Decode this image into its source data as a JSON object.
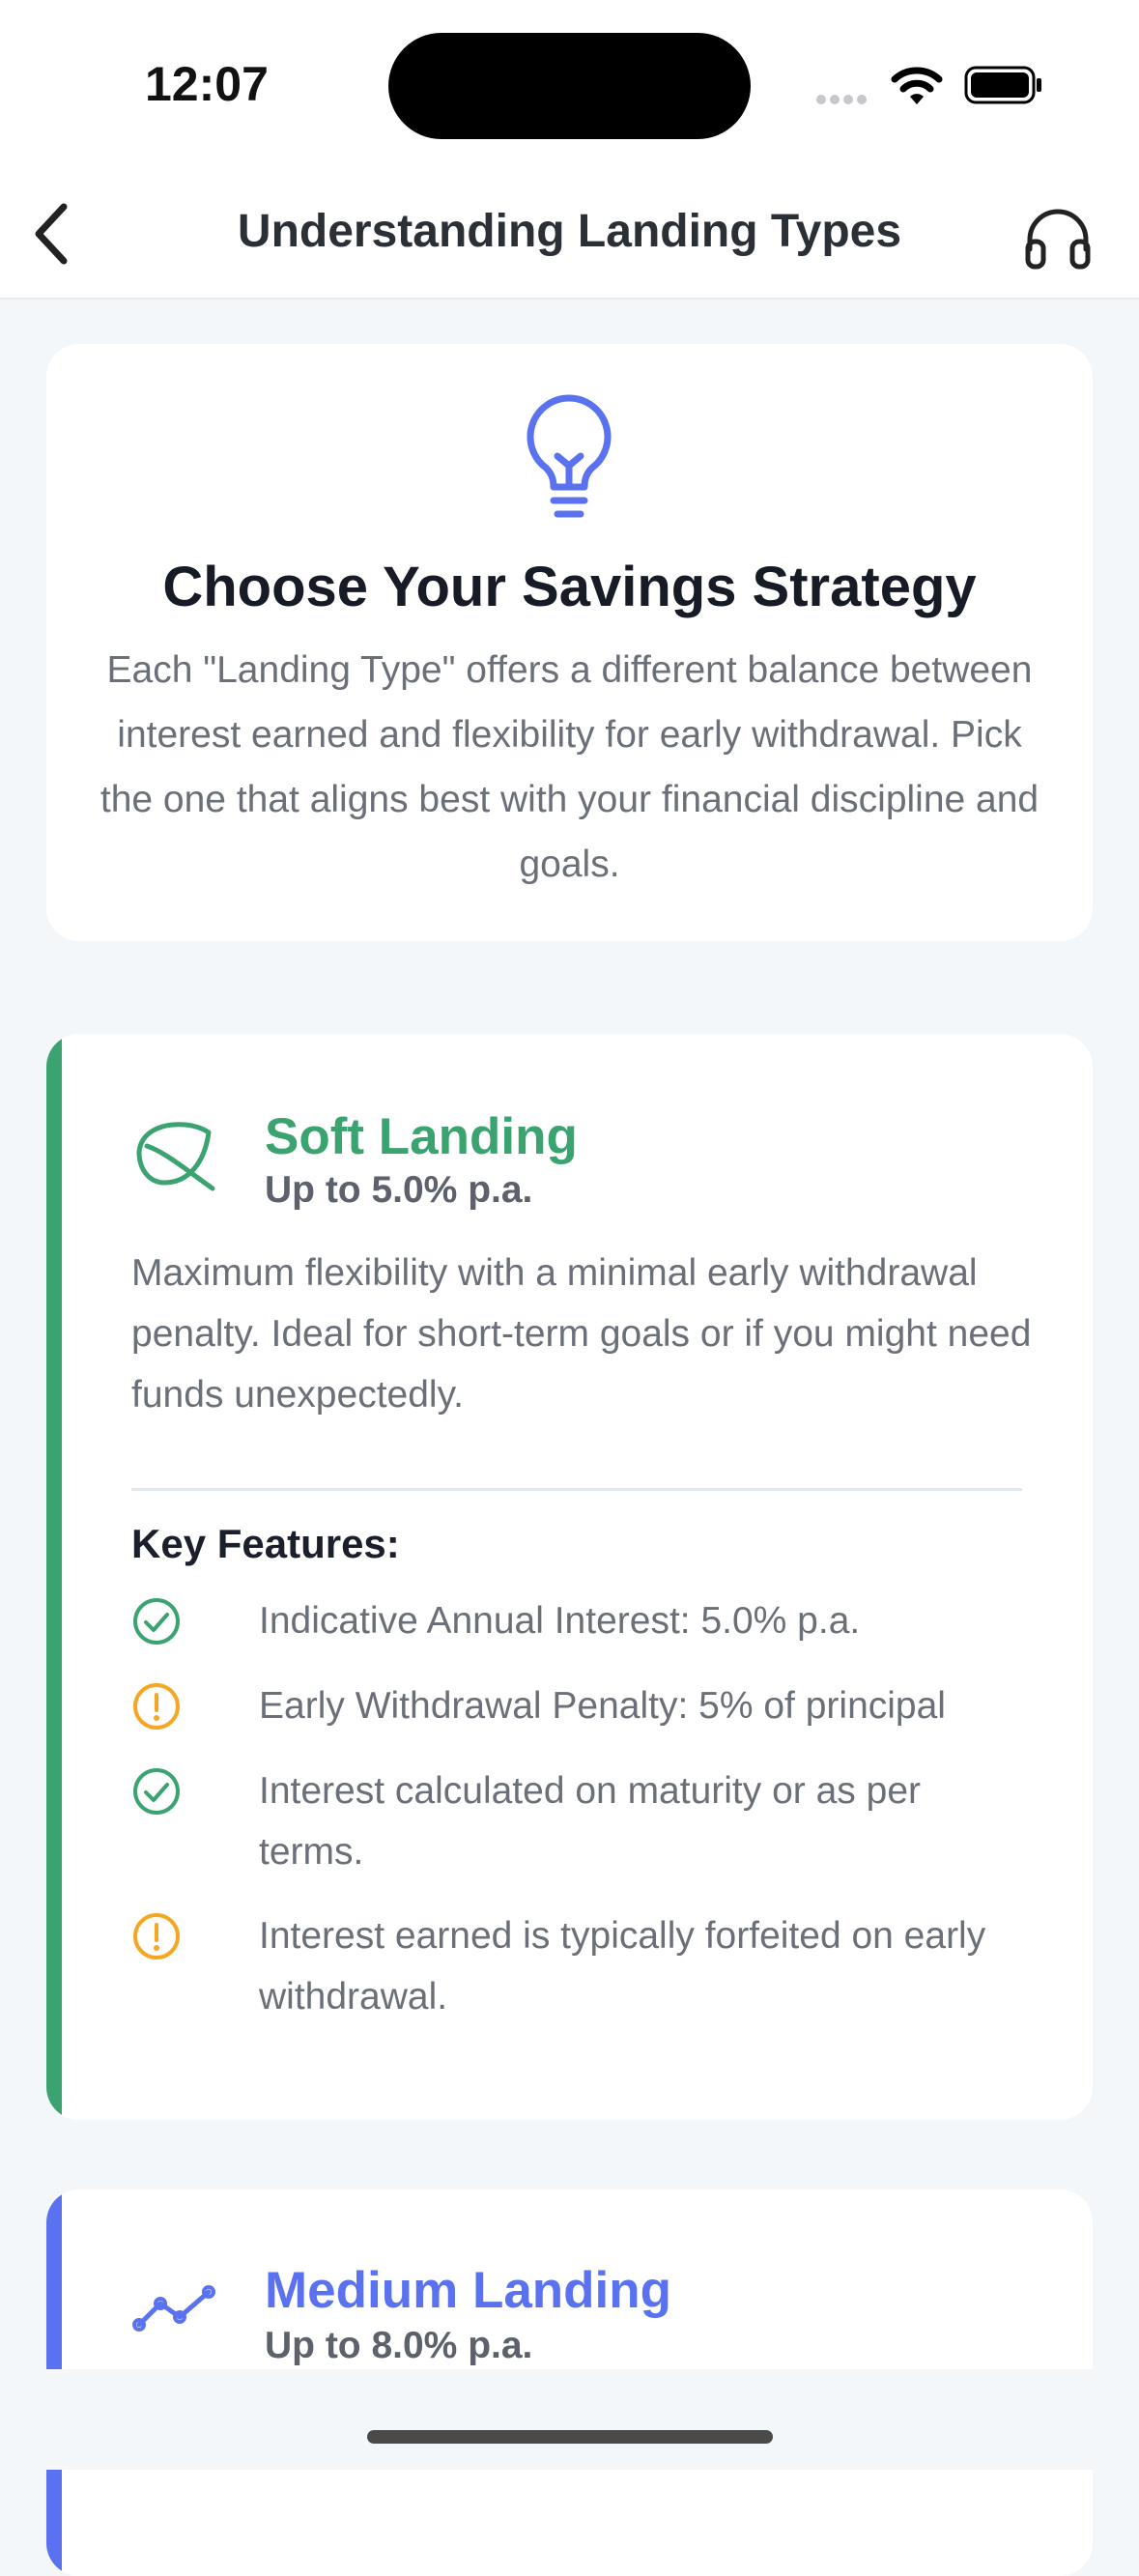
{
  "status_bar": {
    "time": "12:07"
  },
  "nav": {
    "title": "Understanding Landing Types",
    "back_icon": "chevron-left-icon",
    "support_icon": "headphones-icon"
  },
  "intro": {
    "icon": "lightbulb-icon",
    "title": "Choose Your Savings Strategy",
    "description": "Each \"Landing Type\" offers a different balance between interest earned and flexibility for early withdrawal. Pick the one that aligns best with your financial discipline and goals."
  },
  "landing_types": [
    {
      "icon": "leaf-icon",
      "title": "Soft Landing",
      "rate": "Up to 5.0% p.a.",
      "color": "#3aa370",
      "description": "Maximum flexibility with a minimal early withdrawal penalty. Ideal for short-term goals or if you might need funds unexpectedly.",
      "features_heading": "Key Features:",
      "features": [
        {
          "icon": "check-circle-icon",
          "text": "Indicative Annual Interest: 5.0% p.a."
        },
        {
          "icon": "warning-circle-icon",
          "text": "Early Withdrawal Penalty: 5% of principal"
        },
        {
          "icon": "check-circle-icon",
          "text": "Interest calculated on maturity or as per terms."
        },
        {
          "icon": "warning-circle-icon",
          "text": "Interest earned is typically forfeited on early withdrawal."
        }
      ]
    },
    {
      "icon": "trend-line-icon",
      "title": "Medium Landing",
      "rate": "Up to 8.0% p.a.",
      "color": "#5a72f0"
    }
  ],
  "colors": {
    "check": "#3aa370",
    "warning": "#f5a623",
    "accent_blue": "#5a72f0"
  }
}
